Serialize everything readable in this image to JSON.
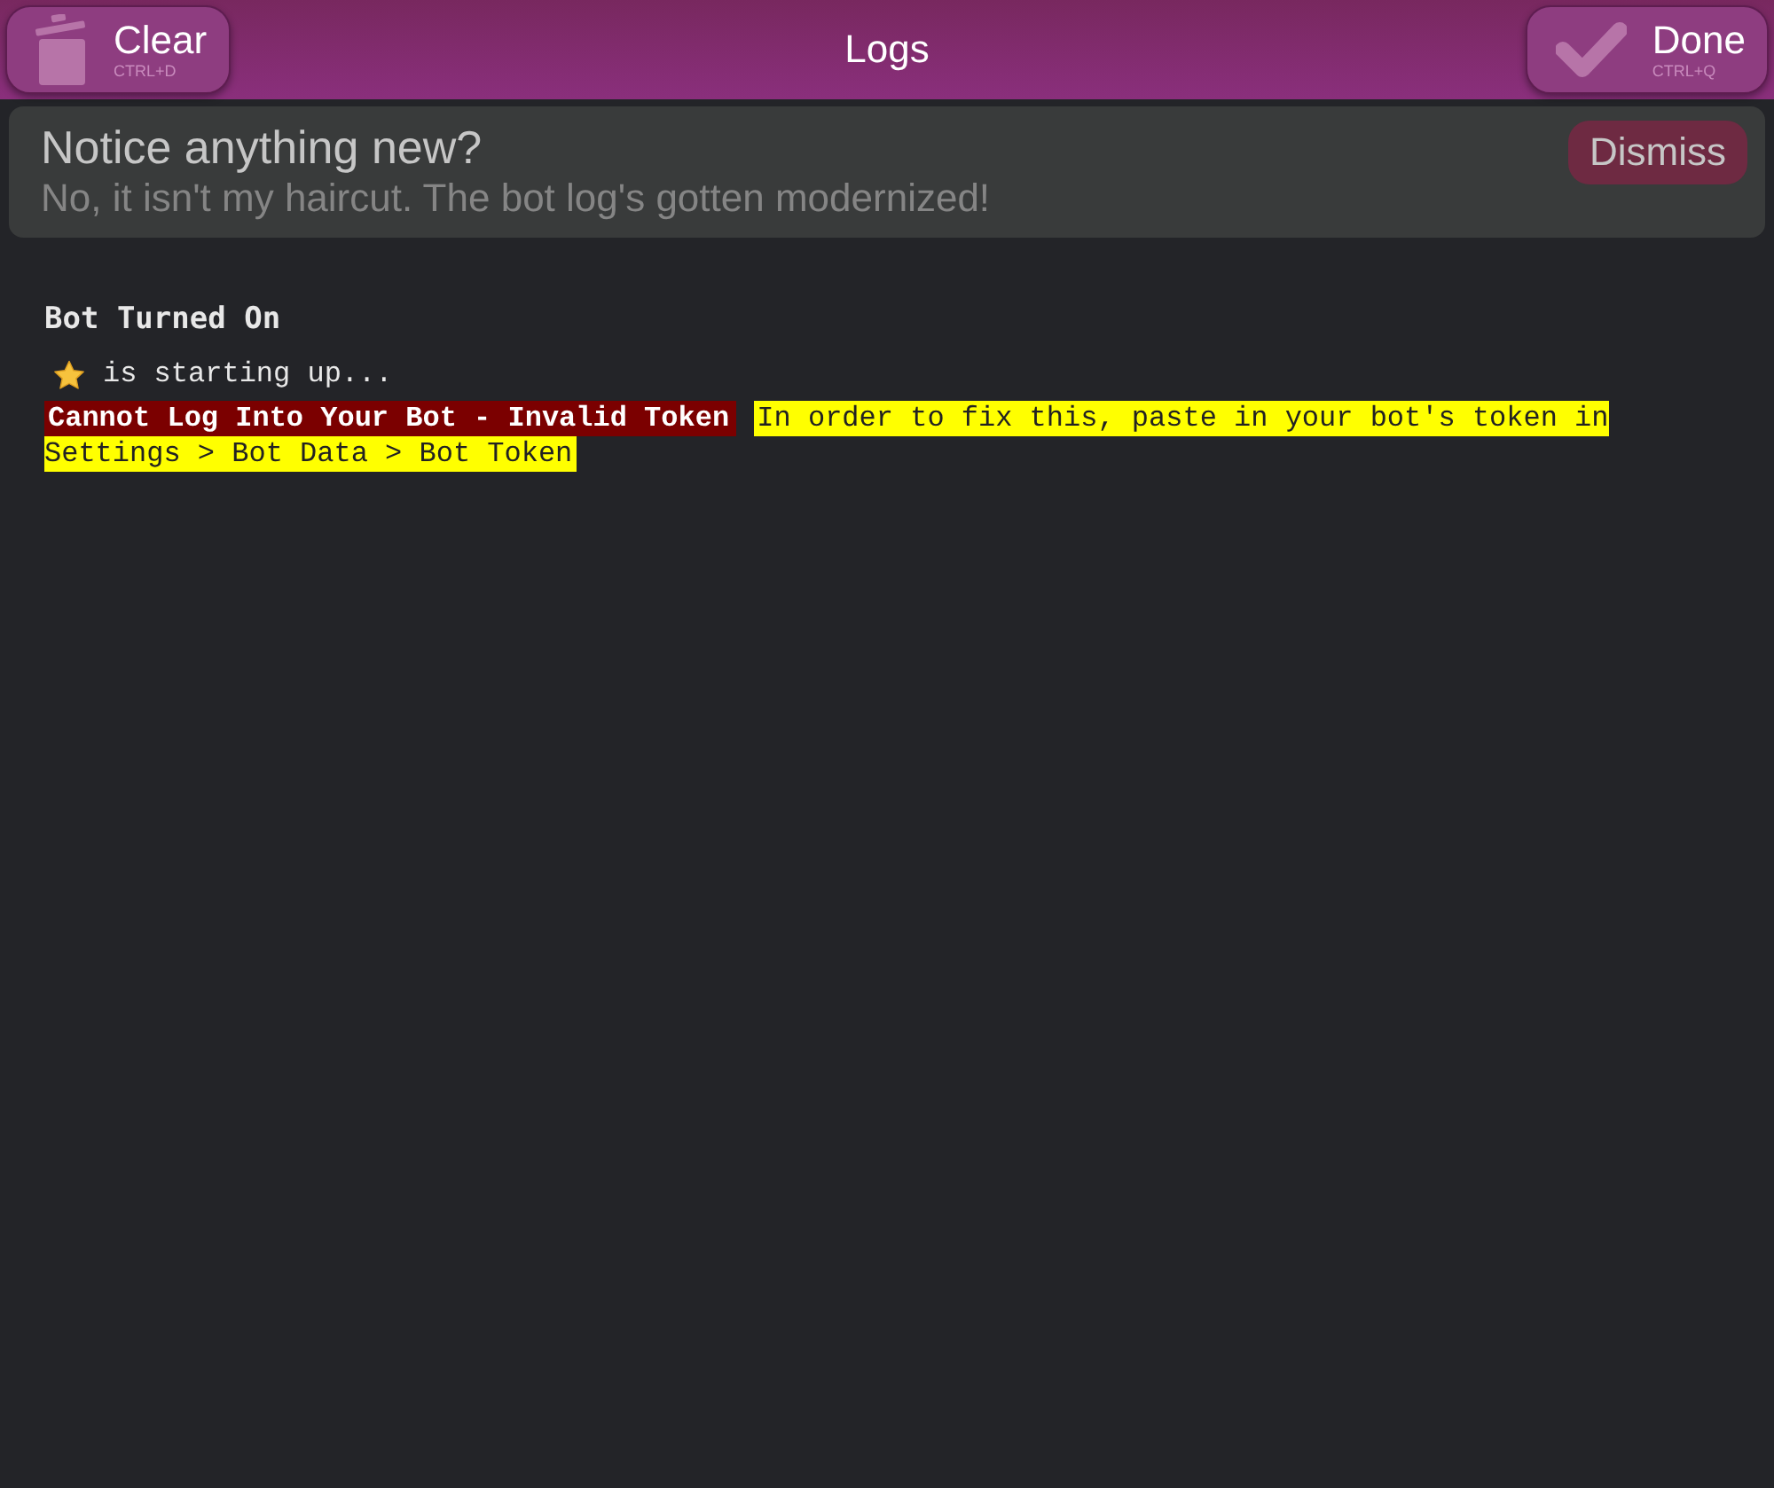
{
  "header": {
    "title": "Logs",
    "buttons": [
      {
        "kind": "clear",
        "label": "Clear",
        "shortcut": "CTRL+D"
      },
      {
        "kind": "done",
        "label": "Done",
        "shortcut": "CTRL+Q"
      }
    ]
  },
  "notice": {
    "title": "Notice anything new?",
    "message": "No, it isn't my haircut. The bot log's gotten modernized!",
    "button": "Dismiss"
  },
  "log": [
    {
      "kind": "heading",
      "text": "Bot Turned On"
    },
    {
      "kind": "status",
      "text": "is starting up..."
    },
    {
      "kind": "error",
      "error": "Cannot Log Into Your Bot - Invalid Token",
      "hint": "In order to fix this, paste in your bot's token in Settings > Bot Data > Bot Token"
    }
  ]
}
